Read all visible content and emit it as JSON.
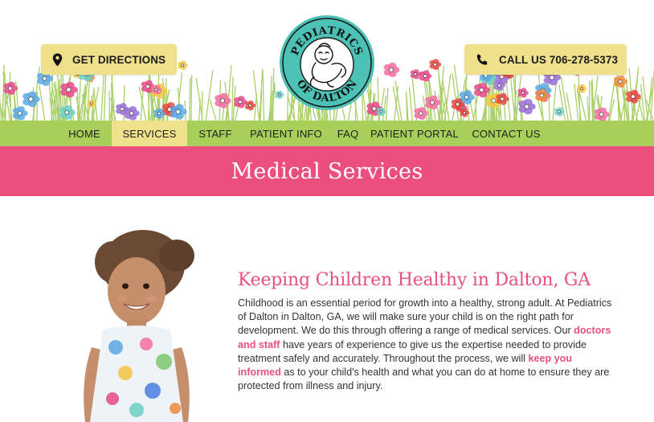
{
  "header": {
    "directions_label": "GET DIRECTIONS",
    "phone_label": "CALL US 706-278-5373",
    "logo": {
      "top_text": "PEDIATRICS",
      "bottom_text": "OF DALTON"
    }
  },
  "nav": {
    "items": [
      {
        "label": "HOME"
      },
      {
        "label": "SERVICES"
      },
      {
        "label": "STAFF"
      },
      {
        "label": "PATIENT INFO"
      },
      {
        "label": "FAQ"
      },
      {
        "label": "PATIENT PORTAL"
      },
      {
        "label": "CONTACT US"
      }
    ],
    "active": "SERVICES"
  },
  "page": {
    "title": "Medical Services"
  },
  "content": {
    "heading": "Keeping Children Healthy in Dalton, GA",
    "para_part1": "Childhood is an essential period for growth into a healthy, strong adult. At Pediatrics of Dalton in Dalton, GA, we will make sure your child is on the right path for development. We do this through offering a range of medical services. Our ",
    "link_staff": "doctors and staff",
    "para_part2": " have years of experience to give us the expertise needed to provide treatment safely and accurately. Throughout the process, we will ",
    "link_informed": "keep you informed",
    "para_part3": " as to your child's health and what you can do at home to ensure they are protected from illness and injury."
  },
  "colors": {
    "nav_bg": "#a8cf5a",
    "nav_active": "#efe08c",
    "pill_bg": "#efe08c",
    "title_band": "#ec4f7e",
    "heading_pink": "#e8507e",
    "logo_teal": "#4cc1b5"
  },
  "icons": {
    "directions": "map-pin-icon",
    "phone": "phone-icon"
  }
}
